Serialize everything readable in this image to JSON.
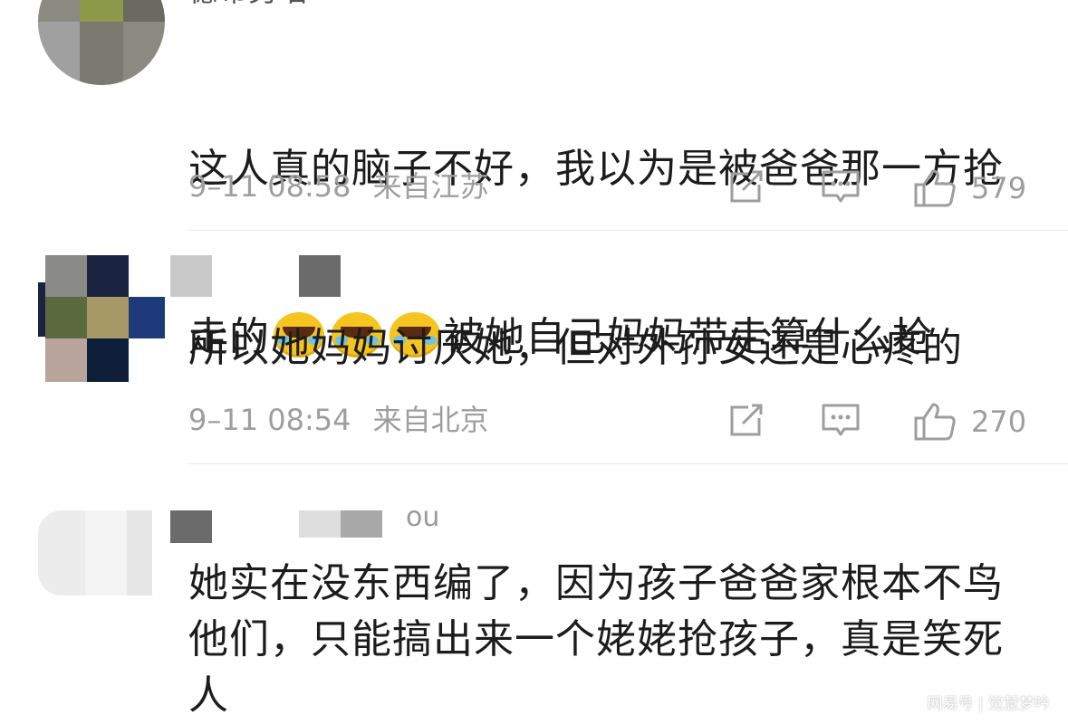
{
  "comments": [
    {
      "username": "德布另喵",
      "text_line1": "这人真的脑子不好，我以为是被爸爸那一方抢",
      "text_line2_a": "走的",
      "text_line2_b": "被她自己妈妈带走算什么抢",
      "emoji_icon": "laughing-crying-emoji",
      "time": "9–11 08:58",
      "location": "来自江苏",
      "likes": "579"
    },
    {
      "text": "所以她妈妈讨厌她，但对外孙女还是心疼的",
      "time": "9–11 08:54",
      "location": "来自北京",
      "likes": "270"
    },
    {
      "username_fragment": "ou",
      "text": "她实在没东西编了，因为孩子爸爸家根本不鸟他们，只能搞出来一个姥姥抢孩子，真是笑死人"
    }
  ],
  "watermark": "网易号 | 觉慧梦吟",
  "colors": {
    "text": "#1c1c1c",
    "meta": "#9e9e9e",
    "divider": "#e8e8e8",
    "emoji": "#f6c41f"
  },
  "icons": [
    "share-icon",
    "comment-icon",
    "like-icon"
  ]
}
